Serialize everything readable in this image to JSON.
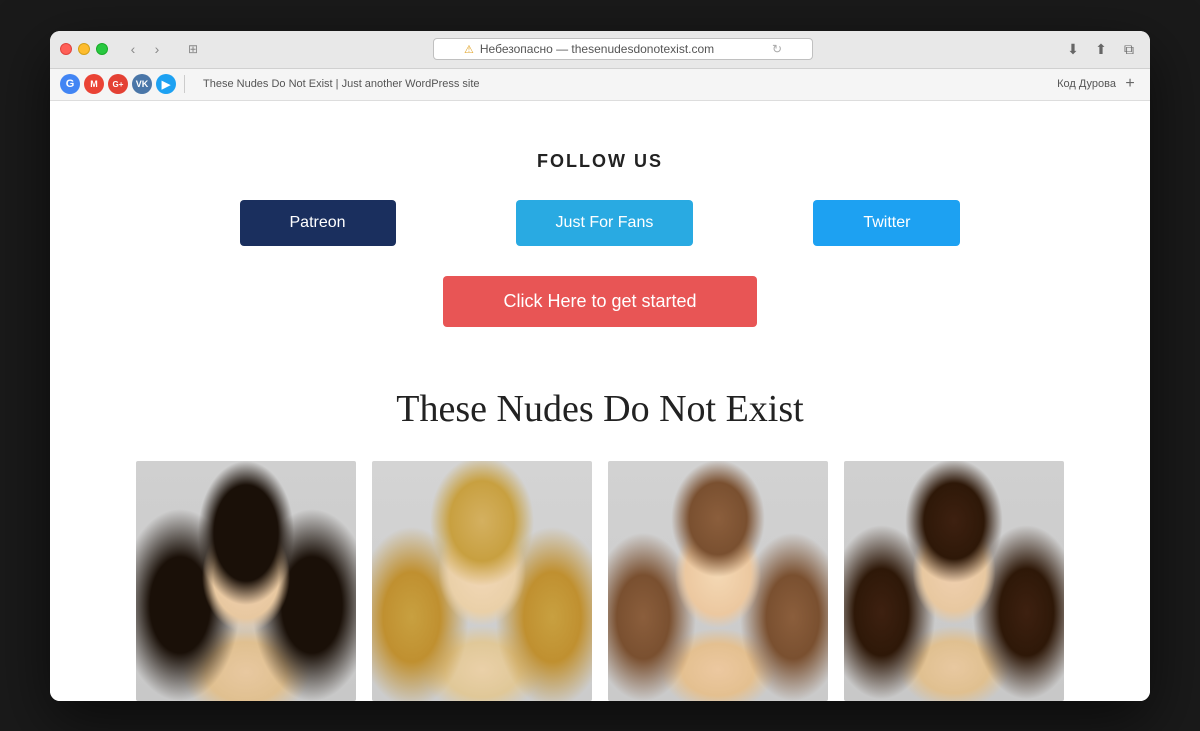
{
  "browser": {
    "address": "Небезопасно — thesenudesdonotexist.com",
    "tab_label": "These Nudes Do Not Exist | Just another WordPress site",
    "bookmarks_right": "Код Дурова",
    "bookmarks": [
      {
        "label": "G",
        "color": "google"
      },
      {
        "label": "●",
        "color": "gmail"
      },
      {
        "label": "G+",
        "color": "gplus"
      },
      {
        "label": "VK",
        "color": "vk"
      },
      {
        "label": "▶",
        "color": "blue"
      }
    ]
  },
  "page": {
    "follow_title": "FOLLOW US",
    "btn_patreon": "Patreon",
    "btn_justforfans": "Just For Fans",
    "btn_twitter": "Twitter",
    "btn_cta": "Click Here to get started",
    "site_title": "These Nudes Do Not Exist",
    "images": [
      {
        "alt": "Person 1 dark hair"
      },
      {
        "alt": "Person 2 blonde"
      },
      {
        "alt": "Person 3 light brown"
      },
      {
        "alt": "Person 4 dark brown"
      }
    ]
  }
}
